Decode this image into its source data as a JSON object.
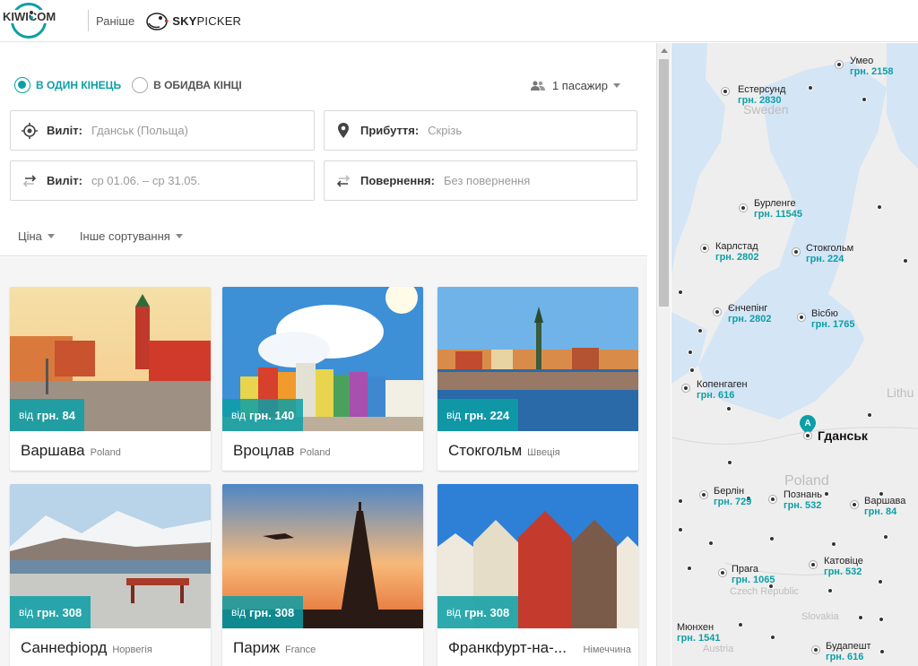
{
  "header": {
    "logo_text_left": "KIWI",
    "logo_text_dot": "•",
    "logo_text_right": "COM",
    "formerly_label": "Раніше",
    "partner_bold": "SKY",
    "partner_rest": "PICKER"
  },
  "search": {
    "trip_types": [
      {
        "label": "В ОДИН КІНЕЦЬ",
        "selected": true
      },
      {
        "label": "В ОБИДВА КІНЦІ",
        "selected": false
      }
    ],
    "passengers": "1 пасажир",
    "from": {
      "label": "Виліт:",
      "value": "Гданськ (Польща)"
    },
    "to": {
      "label": "Прибуття:",
      "value": "Скрізь"
    },
    "departure": {
      "label": "Виліт:",
      "value": "ср 01.06. – ср 31.05."
    },
    "return": {
      "label": "Повернення:",
      "value": "Без повернення"
    },
    "sort_price": "Ціна",
    "sort_other": "Інше сортування"
  },
  "results": [
    {
      "city": "Варшава",
      "country": "Poland",
      "price_prefix": "від",
      "price": "грн. 84"
    },
    {
      "city": "Вроцлав",
      "country": "Poland",
      "price_prefix": "від",
      "price": "грн. 140"
    },
    {
      "city": "Стокгольм",
      "country": "Швеція",
      "price_prefix": "від",
      "price": "грн. 224"
    },
    {
      "city": "Саннефіорд",
      "country": "Норвегія",
      "price_prefix": "від",
      "price": "грн. 308"
    },
    {
      "city": "Париж",
      "country": "France",
      "price_prefix": "від",
      "price": "грн. 308"
    },
    {
      "city": "Франкфурт-на-...",
      "country": "Німеччина",
      "price_prefix": "від",
      "price": "грн. 308"
    }
  ],
  "map": {
    "home_city": "Гданськ",
    "home_marker": "A",
    "ghost_labels": [
      "Sweden",
      "Poland",
      "Lithu",
      "Czech Republic",
      "Slovakia",
      "Austria"
    ],
    "cities": [
      {
        "name": "Умео",
        "price": "грн. 2158"
      },
      {
        "name": "Естерсунд",
        "price": "грн. 2830"
      },
      {
        "name": "Бурленге",
        "price": "грн. 11545"
      },
      {
        "name": "Карлстад",
        "price": "грн. 2802"
      },
      {
        "name": "Стокгольм",
        "price": "грн. 224"
      },
      {
        "name": "Єнчепінг",
        "price": "грн. 2802"
      },
      {
        "name": "Вісбю",
        "price": "грн. 1765"
      },
      {
        "name": "Копенгаген",
        "price": "грн. 616"
      },
      {
        "name": "Берлін",
        "price": "грн. 729"
      },
      {
        "name": "Познань",
        "price": "грн. 532"
      },
      {
        "name": "Варшава",
        "price": "грн. 84"
      },
      {
        "name": "Прага",
        "price": "грн. 1065"
      },
      {
        "name": "Катовіце",
        "price": "грн. 532"
      },
      {
        "name": "Мюнхен",
        "price": "грн. 1541"
      },
      {
        "name": "Будапешт",
        "price": "грн. 616"
      }
    ]
  },
  "colors": {
    "accent": "#0c9fa6",
    "sea": "#d4e5f5",
    "land": "#eeeeee"
  }
}
